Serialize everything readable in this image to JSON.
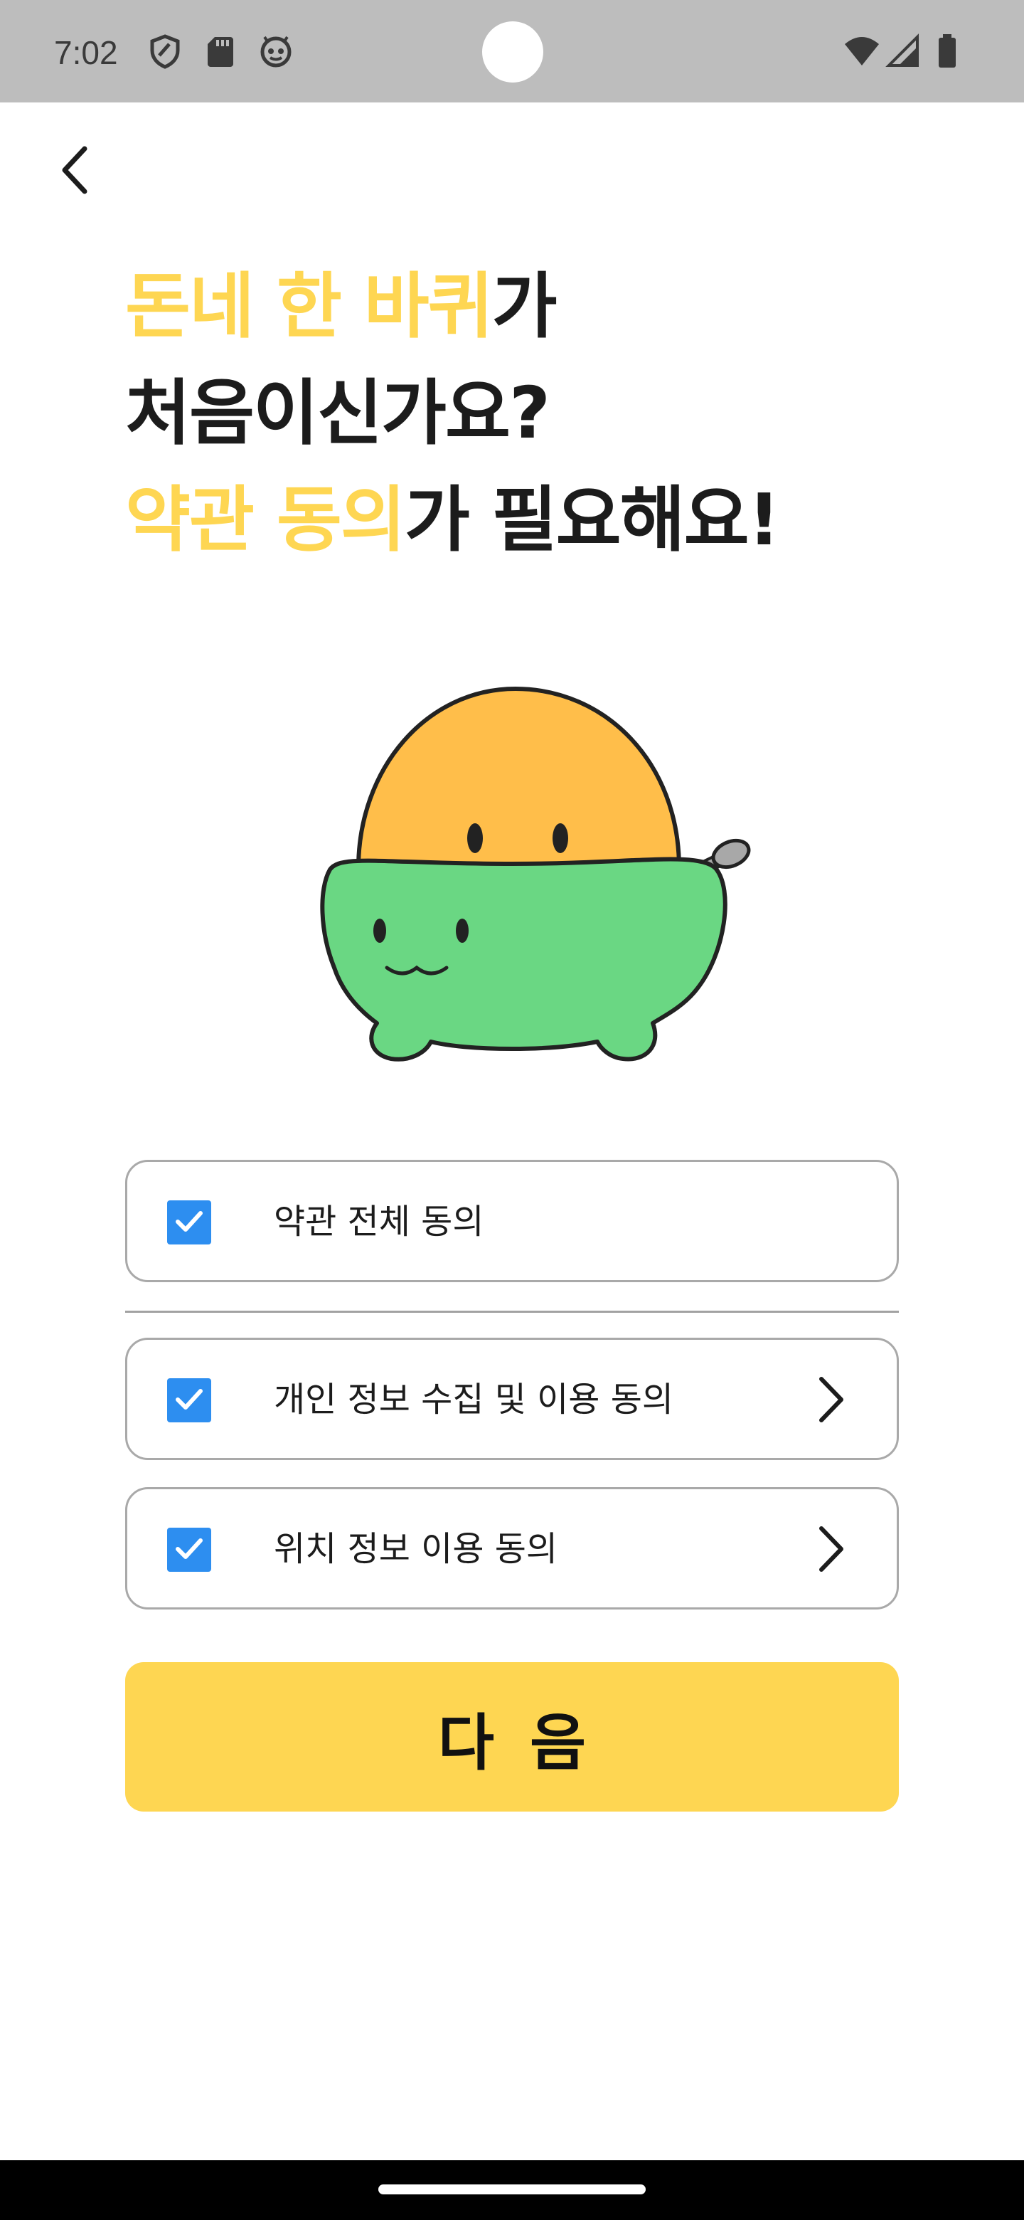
{
  "status_bar": {
    "time": "7:02",
    "left_icons": [
      "shield-icon",
      "sd-card-icon",
      "robot-face-icon"
    ],
    "right_icons": [
      "wifi-icon",
      "signal-icon",
      "battery-icon"
    ]
  },
  "navigation": {
    "back_icon": "chevron-left-icon"
  },
  "headline": {
    "line1_accent": "돈네 한 바퀴",
    "line1_rest": "가",
    "line2": "처음이신가요?",
    "line3_accent": "약관 동의",
    "line3_rest": "가 필요해요!"
  },
  "mascot": {
    "description_icon": "mascot-bowl-illustration"
  },
  "agreements": {
    "all": {
      "label": "약관 전체 동의",
      "checked": true
    },
    "items": [
      {
        "label": "개인 정보 수집 및 이용 동의",
        "checked": true,
        "has_detail": true
      },
      {
        "label": "위치 정보 이용 동의",
        "checked": true,
        "has_detail": true
      }
    ]
  },
  "next_button": {
    "label": "다음"
  },
  "colors": {
    "accent_yellow": "#fed652",
    "checkbox_blue": "#2d8ef0",
    "text_dark": "#1c1c1c",
    "status_bar_gray": "#bdbdbd",
    "mascot_orange": "#ffbe4a",
    "mascot_green": "#6ad783"
  }
}
